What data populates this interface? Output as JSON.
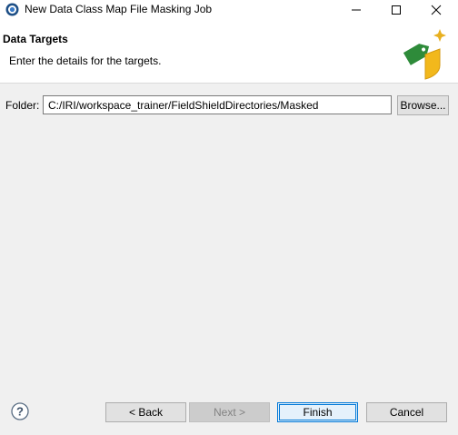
{
  "window": {
    "title": "New Data Class Map File Masking Job"
  },
  "banner": {
    "title": "Data Targets",
    "description": "Enter the details for the targets."
  },
  "form": {
    "folder_label": "Folder:",
    "folder_value": "C:/IRI/workspace_trainer/FieldShieldDirectories/Masked",
    "browse_label": "Browse..."
  },
  "footer": {
    "back_label": "< Back",
    "next_label": "Next >",
    "finish_label": "Finish",
    "cancel_label": "Cancel"
  },
  "colors": {
    "accent": "#0078d7",
    "tag_green": "#2e8b3a",
    "shield_gold": "#f2b81c"
  },
  "icons": [
    "app-icon",
    "minimize-icon",
    "maximize-icon",
    "close-icon",
    "tag-shield-icon",
    "help-icon"
  ]
}
